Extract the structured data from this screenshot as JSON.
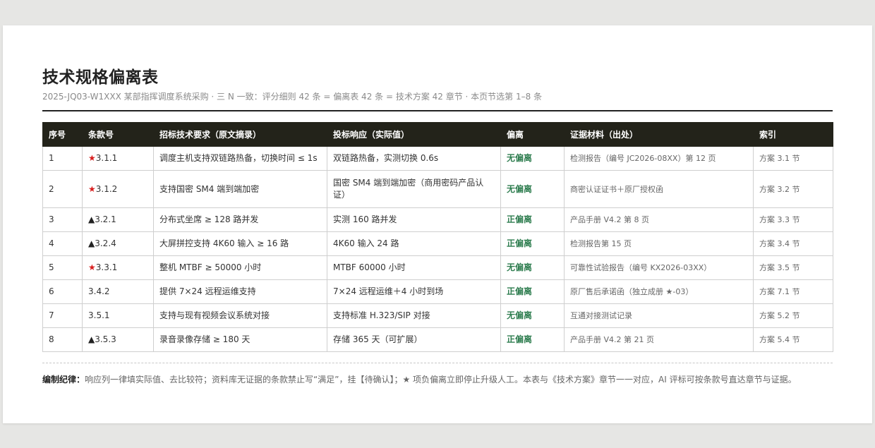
{
  "title": "技术规格偏离表",
  "subtitle": "2025-JQ03-W1XXX 某部指挥调度系统采购 · 三 N 一致：评分细则 42 条 = 偏离表 42 条 = 技术方案 42 章节 · 本页节选第 1–8 条",
  "table": {
    "headers": [
      "序号",
      "条款号",
      "招标技术要求（原文摘录）",
      "投标响应（实际值）",
      "偏离",
      "证据材料（出处）",
      "索引"
    ],
    "rows": [
      {
        "no": "1",
        "mark": "★",
        "clause": "3.1.1",
        "req": "调度主机支持双链路热备，切换时间 ≤ 1s",
        "resp": "双链路热备，实测切换 0.6s",
        "dev": "无偏离",
        "evidence": "检测报告（编号 JC2026-08XX）第 12 页",
        "index": "方案 3.1 节"
      },
      {
        "no": "2",
        "mark": "★",
        "clause": "3.1.2",
        "req": "支持国密 SM4 端到端加密",
        "resp": "国密 SM4 端到端加密（商用密码产品认证）",
        "dev": "无偏离",
        "evidence": "商密认证证书＋原厂授权函",
        "index": "方案 3.2 节"
      },
      {
        "no": "3",
        "mark": "▲",
        "clause": "3.2.1",
        "req": "分布式坐席 ≥ 128 路并发",
        "resp": "实测 160 路并发",
        "dev": "正偏离",
        "evidence": "产品手册 V4.2 第 8 页",
        "index": "方案 3.3 节"
      },
      {
        "no": "4",
        "mark": "▲",
        "clause": "3.2.4",
        "req": "大屏拼控支持 4K60 输入 ≥ 16 路",
        "resp": "4K60 输入 24 路",
        "dev": "正偏离",
        "evidence": "检测报告第 15 页",
        "index": "方案 3.4 节"
      },
      {
        "no": "5",
        "mark": "★",
        "clause": "3.3.1",
        "req": "整机 MTBF ≥ 50000 小时",
        "resp": "MTBF 60000 小时",
        "dev": "无偏离",
        "evidence": "可靠性试验报告（编号 KX2026-03XX）",
        "index": "方案 3.5 节"
      },
      {
        "no": "6",
        "mark": "",
        "clause": "3.4.2",
        "req": "提供 7×24 远程运维支持",
        "resp": "7×24 远程运维＋4 小时到场",
        "dev": "正偏离",
        "evidence": "原厂售后承诺函（独立成册 ★-03）",
        "index": "方案 7.1 节"
      },
      {
        "no": "7",
        "mark": "",
        "clause": "3.5.1",
        "req": "支持与现有视频会议系统对接",
        "resp": "支持标准 H.323/SIP 对接",
        "dev": "无偏离",
        "evidence": "互通对接测试记录",
        "index": "方案 5.2 节"
      },
      {
        "no": "8",
        "mark": "▲",
        "clause": "3.5.3",
        "req": "录音录像存储 ≥ 180 天",
        "resp": "存储 365 天（可扩展）",
        "dev": "正偏离",
        "evidence": "产品手册 V4.2 第 21 页",
        "index": "方案 5.4 节"
      }
    ]
  },
  "note": {
    "label": "编制纪律：",
    "text": "响应列一律填实际值、去比较符；资料库无证据的条款禁止写“满足”，挂【待确认】；★ 项负偏离立即停止升级人工。本表与《技术方案》章节一一对应，AI 评标可按条款号直达章节与证据。"
  },
  "colors": {
    "header_bg": "#23231a",
    "deviation_text": "#2e7d4f",
    "star_mark": "#d81e1e"
  }
}
